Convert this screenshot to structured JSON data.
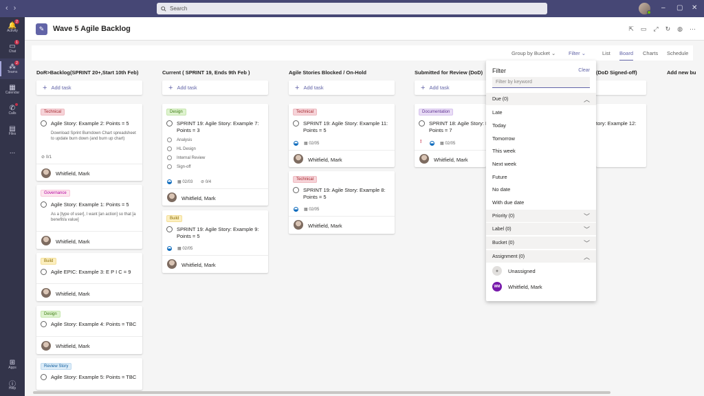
{
  "search": {
    "placeholder": "Search"
  },
  "rail": [
    {
      "label": "Activity",
      "badge": "2"
    },
    {
      "label": "Chat",
      "badge": "1"
    },
    {
      "label": "Teams",
      "badge": "2"
    },
    {
      "label": "Calendar",
      "badge": ""
    },
    {
      "label": "Calls",
      "badge": ""
    },
    {
      "label": "Files",
      "badge": ""
    },
    {
      "label": "...",
      "badge": ""
    },
    {
      "label": "Apps",
      "badge": ""
    },
    {
      "label": "Help",
      "badge": ""
    }
  ],
  "header": {
    "title": "Wave 5 Agile Backlog"
  },
  "toolbar": {
    "group_by": "Group by Bucket",
    "filter": "Filter",
    "list": "List",
    "board": "Board",
    "charts": "Charts",
    "schedule": "Schedule"
  },
  "columns": [
    {
      "title": "DoR>Backlog(SPRINT 20+,Start 10th Feb)",
      "add": "Add task"
    },
    {
      "title": "Current ( SPRINT 19, Ends 9th Feb )",
      "add": "Add task"
    },
    {
      "title": "Agile Stories Blocked / On-Hold",
      "add": "Add task"
    },
    {
      "title": "Submitted for Review (DoD)",
      "add": "Add task"
    },
    {
      "title": "(DoD Signed-off)",
      "add": ""
    },
    {
      "title": "Add new bu",
      "add": ""
    }
  ],
  "cards": {
    "c1": {
      "tag": "Technical",
      "title": "Agile Story: Example 2: Points = 5",
      "desc": "Download Sprint Burndown Chart spreadsheet to update burn down (and burn up chart)",
      "checklist": "0/1",
      "assignee": "Whitfield, Mark"
    },
    "c2": {
      "tag": "Governance",
      "title": "Agile Story: Example 1: Points = 5",
      "desc": "As a [type of user], I want [an action] so that [a benefit/a value]",
      "assignee": "Whitfield, Mark"
    },
    "c3": {
      "tag": "Build",
      "title": "Agile EPIC: Example 3: E P I C = 9",
      "assignee": "Whitfield, Mark"
    },
    "c4": {
      "tag": "Design",
      "title": "Agile Story: Example 4: Points = TBC",
      "assignee": "Whitfield, Mark"
    },
    "c5": {
      "tag": "Review Story",
      "title": "Agile Story: Example 5: Points = TBC"
    },
    "c6": {
      "tag": "Design",
      "title": "SPRINT 19: Agile Story: Example 7: Points = 3",
      "checks": [
        "Analysis",
        "HL Design",
        "Internal Review",
        "Sign-off"
      ],
      "date": "02/03",
      "checklist": "0/4",
      "assignee": "Whitfield, Mark"
    },
    "c7": {
      "tag": "Build",
      "title": "SPRINT 19: Agile Story: Example 9: Points = 5",
      "date": "02/05",
      "assignee": "Whitfield, Mark"
    },
    "c8": {
      "tag": "Technical",
      "title": "SPRINT 19: Agile Story: Example 11: Points = 5",
      "date": "02/05",
      "assignee": "Whitfield, Mark"
    },
    "c9": {
      "tag": "Technical",
      "title": "SPRINT 19: Agile Story: Example 8: Points = 5",
      "date": "02/05",
      "assignee": "Whitfield, Mark"
    },
    "c10": {
      "tag": "Documentation",
      "title": "SPRINT 18: Agile Story: Ex",
      "title2": "Points = 7",
      "date": "02/05",
      "assignee": "Whitfield, Mark"
    },
    "c11": {
      "title": "tory: Example 12:"
    }
  },
  "filter": {
    "title": "Filter",
    "clear": "Clear",
    "placeholder": "Filter by keyword",
    "due_header": "Due (0)",
    "due_options": [
      "Late",
      "Today",
      "Tomorrow",
      "This week",
      "Next week",
      "Future",
      "No date",
      "With due date"
    ],
    "priority": "Priority (0)",
    "label": "Label (0)",
    "bucket": "Bucket (0)",
    "assignment": "Assignment (0)",
    "unassigned": "Unassigned",
    "user": "Whitfield, Mark",
    "user_initials": "WM"
  }
}
